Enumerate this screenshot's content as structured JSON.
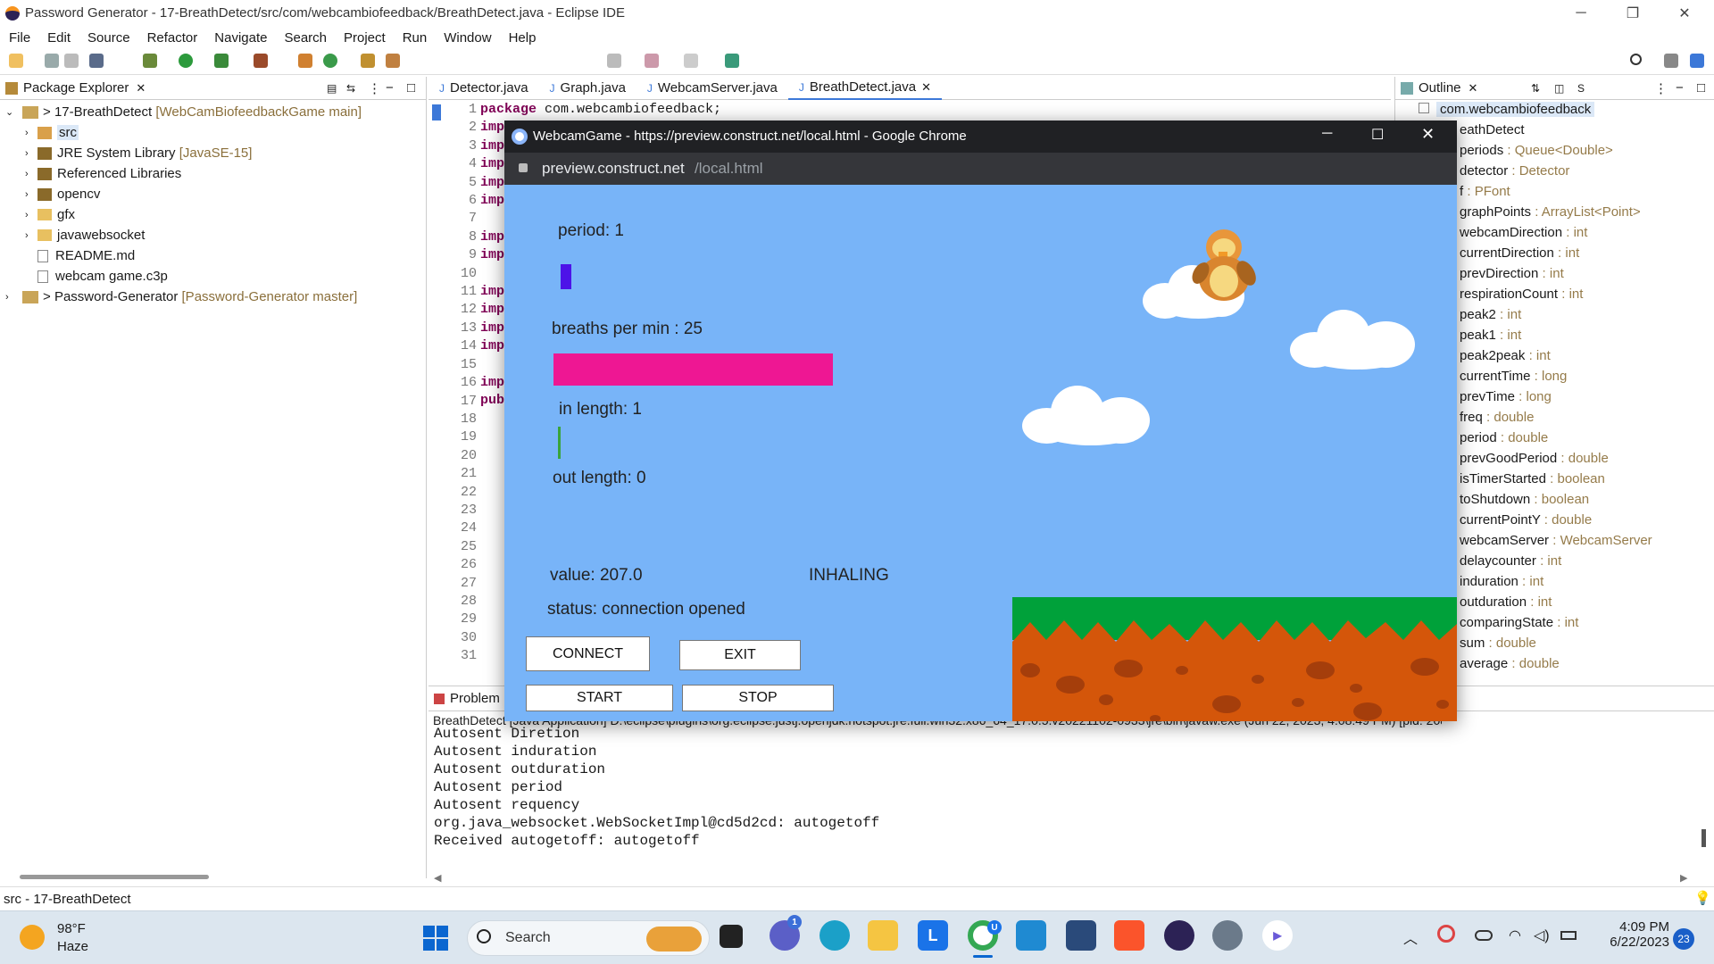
{
  "window": {
    "title": "Password Generator - 17-BreathDetect/src/com/webcambiofeedback/BreathDetect.java - Eclipse IDE"
  },
  "menu": [
    "File",
    "Edit",
    "Source",
    "Refactor",
    "Navigate",
    "Search",
    "Project",
    "Run",
    "Window",
    "Help"
  ],
  "package_explorer": {
    "title": "Package Explorer",
    "project": "17-BreathDetect",
    "project_repo": "[WebCamBiofeedbackGame main]",
    "items": [
      "src",
      "JRE System Library",
      "Referenced Libraries",
      "opencv",
      "gfx",
      "javawebsocket",
      "README.md",
      "webcam game.c3p"
    ],
    "jre_tag": "[JavaSE-15]",
    "project2": "Password-Generator",
    "project2_repo": "[Password-Generator master]"
  },
  "editor": {
    "tabs": [
      "Detector.java",
      "Graph.java",
      "WebcamServer.java",
      "BreathDetect.java"
    ],
    "line1_kw": "package",
    "line1_rest": " com.webcambiofeedback;",
    "lines": [
      "1",
      "2",
      "3",
      "4",
      "5",
      "6",
      "7",
      "8",
      "9",
      "10",
      "11",
      "12",
      "13",
      "14",
      "15",
      "16",
      "17",
      "18",
      "19",
      "20",
      "21",
      "22",
      "23",
      "24",
      "25",
      "26",
      "27",
      "28",
      "29",
      "30",
      "31"
    ],
    "imp": "imp",
    "pub": "pub"
  },
  "outline": {
    "title": "Outline",
    "package": "com.webcambiofeedback",
    "class": "eathDetect",
    "fields": [
      {
        "n": "periods",
        "t": "Queue<Double>"
      },
      {
        "n": "detector",
        "t": "Detector"
      },
      {
        "n": "f",
        "t": "PFont"
      },
      {
        "n": "graphPoints",
        "t": "ArrayList<Point>"
      },
      {
        "n": "webcamDirection",
        "t": "int"
      },
      {
        "n": "currentDirection",
        "t": "int"
      },
      {
        "n": "prevDirection",
        "t": "int"
      },
      {
        "n": "respirationCount",
        "t": "int"
      },
      {
        "n": "peak2",
        "t": "int"
      },
      {
        "n": "peak1",
        "t": "int"
      },
      {
        "n": "peak2peak",
        "t": "int"
      },
      {
        "n": "currentTime",
        "t": "long"
      },
      {
        "n": "prevTime",
        "t": "long"
      },
      {
        "n": "freq",
        "t": "double"
      },
      {
        "n": "period",
        "t": "double"
      },
      {
        "n": "prevGoodPeriod",
        "t": "double"
      },
      {
        "n": "isTimerStarted",
        "t": "boolean"
      },
      {
        "n": "toShutdown",
        "t": "boolean"
      },
      {
        "n": "currentPointY",
        "t": "double"
      },
      {
        "n": "webcamServer",
        "t": "WebcamServer"
      },
      {
        "n": "delaycounter",
        "t": "int"
      },
      {
        "n": "induration",
        "t": "int"
      },
      {
        "n": "outduration",
        "t": "int"
      },
      {
        "n": "comparingState",
        "t": "int"
      },
      {
        "n": "sum",
        "t": "double"
      },
      {
        "n": "average",
        "t": "double"
      }
    ]
  },
  "console": {
    "tab": "Problem",
    "launch": "BreathDetect [Java Application] D:\\eclipse\\plugins\\org.eclipse.justj.openjdk.hotspot.jre.full.win32.x86_64_17.0.5.v20221102-0933\\jre\\bin\\javaw.exe  (Jun 22, 2023, 4:08:49 PM) [pid: 20888]",
    "lines": [
      "Autosent Diretion",
      "Autosent induration",
      "Autosent outduration",
      "Autosent period",
      "Autosent requency",
      "org.java_websocket.WebSocketImpl@cd5d2cd: autogetoff",
      "Received autogetoff: autogetoff"
    ]
  },
  "status_bar": "src - 17-BreathDetect",
  "chrome": {
    "title": "WebcamGame - https://preview.construct.net/local.html - Google Chrome",
    "url_host": "preview.construct.net",
    "url_path": "/local.html"
  },
  "game": {
    "period": "period: 1",
    "bpm": "breaths per min : 25",
    "in_length": "in length: 1",
    "out_length": "out length: 0",
    "value": "value: 207.0",
    "state": "INHALING",
    "status": "status: connection opened",
    "buttons": {
      "connect": "CONNECT",
      "exit": "EXIT",
      "start": "START",
      "stop": "STOP"
    },
    "bar_color": "#ee1793"
  },
  "taskbar": {
    "temp": "98°F",
    "weather": "Haze",
    "search": "Search",
    "time": "4:09 PM",
    "date": "6/22/2023",
    "notif": "23",
    "chat_badge": "1",
    "chrome_badge": "U"
  }
}
